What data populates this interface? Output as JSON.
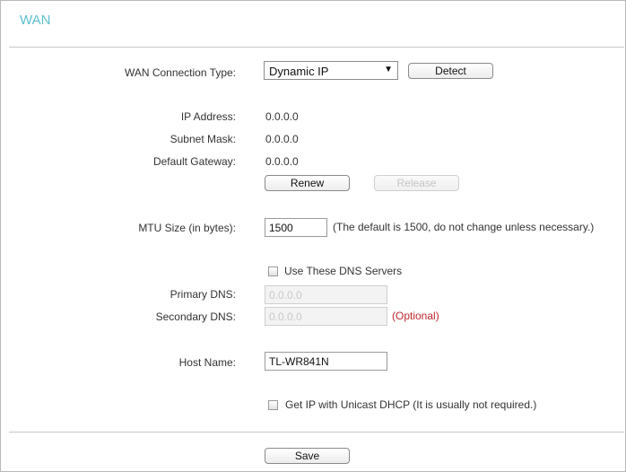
{
  "section_title": "WAN",
  "connection_type": {
    "label": "WAN Connection Type:",
    "selected": "Dynamic IP",
    "detect_label": "Detect"
  },
  "ip_address": {
    "label": "IP Address:",
    "value": "0.0.0.0"
  },
  "subnet_mask": {
    "label": "Subnet Mask:",
    "value": "0.0.0.0"
  },
  "default_gateway": {
    "label": "Default Gateway:",
    "value": "0.0.0.0"
  },
  "renew_label": "Renew",
  "release_label": "Release",
  "mtu": {
    "label": "MTU Size (in bytes):",
    "value": "1500",
    "hint": "(The default is 1500, do not change unless necessary.)"
  },
  "dns": {
    "checkbox_label": "Use These DNS Servers",
    "primary_label": "Primary DNS:",
    "primary_value": "0.0.0.0",
    "secondary_label": "Secondary DNS:",
    "secondary_value": "0.0.0.0",
    "optional_text": "(Optional)"
  },
  "host_name": {
    "label": "Host Name:",
    "value": "TL-WR841N"
  },
  "unicast": {
    "label": "Get IP with Unicast DHCP (It is usually not required.)"
  },
  "save_label": "Save"
}
